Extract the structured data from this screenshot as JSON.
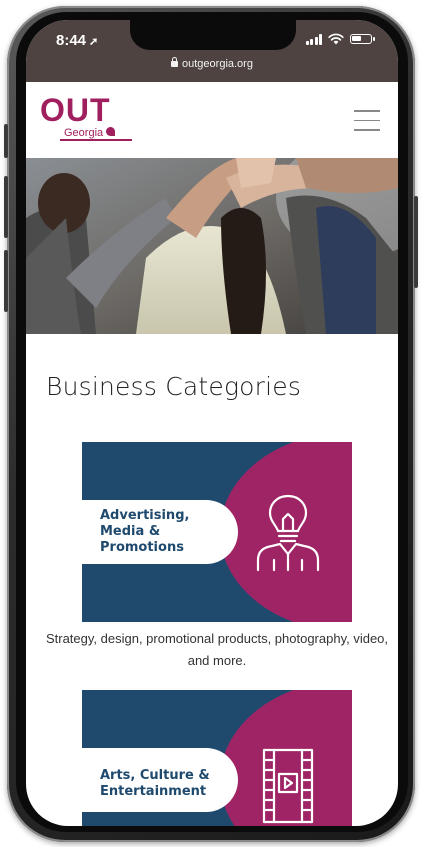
{
  "status_bar": {
    "time": "8:44",
    "location_arrow": "➚",
    "battery_level": 0.55
  },
  "browser": {
    "url": "outgeorgia.org"
  },
  "site": {
    "logo_main": "OUT",
    "logo_sub": "Georgia",
    "menu_icon": "hamburger-icon"
  },
  "page": {
    "section_title": "Business Categories"
  },
  "categories": [
    {
      "label": "Advertising,\nMedia &\nPromotions",
      "icon": "lightbulb-person-icon",
      "description": "Strategy, design, promotional products, photography, video, and more."
    },
    {
      "label": "Arts, Culture &\nEntertainment",
      "icon": "film-strip-icon",
      "description": ""
    }
  ],
  "colors": {
    "brand_magenta": "#9f2466",
    "brand_navy": "#1f4a6e",
    "status_bar_bg": "#4e4340"
  }
}
